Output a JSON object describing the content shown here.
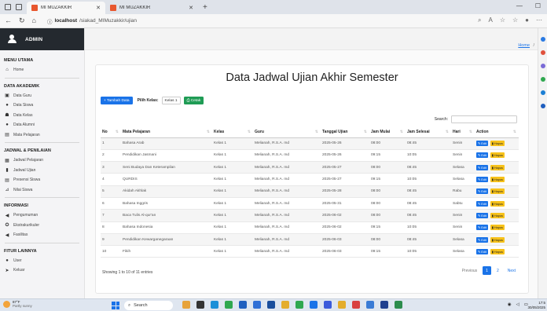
{
  "browser": {
    "tabs": [
      {
        "label": "MI MUZAKKIR",
        "active": true
      },
      {
        "label": "MI MUZAKKIR",
        "active": false
      }
    ],
    "address": {
      "host": "localhost",
      "path": "/siakad_MIMuzakkir/ujian"
    }
  },
  "sidebar": {
    "brand": "ADMIN",
    "sections": [
      {
        "title": "MENU UTAMA",
        "items": [
          {
            "label": "Home",
            "icon": "home-icon",
            "glyph": "⌂"
          }
        ]
      },
      {
        "title": "DATA AKADEMIK",
        "items": [
          {
            "label": "Data Guru",
            "icon": "teacher-icon",
            "glyph": "▣"
          },
          {
            "label": "Data Siswa",
            "icon": "student-icon",
            "glyph": "●"
          },
          {
            "label": "Data Kelas",
            "icon": "class-icon",
            "glyph": "☗"
          },
          {
            "label": "Data Alumni",
            "icon": "alumni-icon",
            "glyph": "●"
          },
          {
            "label": "Mata Pelajaran",
            "icon": "book-icon",
            "glyph": "▤"
          }
        ]
      },
      {
        "title": "JADWAL & PENILAIAN",
        "items": [
          {
            "label": "Jadwal Pelajaran",
            "icon": "calendar-icon",
            "glyph": "▦"
          },
          {
            "label": "Jadwal Ujian",
            "icon": "exam-icon",
            "glyph": "▮"
          },
          {
            "label": "Presensi Siswa",
            "icon": "attendance-icon",
            "glyph": "▤"
          },
          {
            "label": "Nilai Siswa",
            "icon": "chart-icon",
            "glyph": "⊿"
          }
        ]
      },
      {
        "title": "INFORMASI",
        "items": [
          {
            "label": "Pengumuman",
            "icon": "megaphone-icon",
            "glyph": "◀"
          },
          {
            "label": "Ekstrakurikuler",
            "icon": "activity-icon",
            "glyph": "✪"
          },
          {
            "label": "Fasilitas",
            "icon": "facility-icon",
            "glyph": "◀"
          }
        ]
      },
      {
        "title": "FITUR LAINNYA",
        "items": [
          {
            "label": "User",
            "icon": "user-icon",
            "glyph": "●"
          },
          {
            "label": "Keluar",
            "icon": "logout-icon",
            "glyph": "➤"
          }
        ]
      }
    ]
  },
  "breadcrumb": {
    "home": "Home",
    "sep": "/"
  },
  "page": {
    "title": "Data Jadwal Ujian Akhir Semester",
    "add_button": "+ Tambah Data",
    "filter_label": "Pilih Kelas:",
    "filter_value": "Kelas 1",
    "print_button": "⎙ Cetak",
    "search_label": "Search:"
  },
  "table": {
    "headers": [
      "No",
      "Mata Pelajaran",
      "Kelas",
      "Guru",
      "Tanggal Ujian",
      "Jam Mulai",
      "Jam Selesai",
      "Hari",
      "Action"
    ],
    "edit_label": "✎ Edit",
    "delete_label": "▮ Hapus",
    "rows": [
      [
        "1",
        "Bahasa Arab",
        "Kelas 1",
        "Melianah, R.S.A. md",
        "2025-05-26",
        "08:00",
        "08:45",
        "Senin"
      ],
      [
        "2",
        "Pendidikan Jasmani",
        "Kelas 1",
        "Melianah, R.S.A. md",
        "2025-05-26",
        "09:15",
        "10:05",
        "Senin"
      ],
      [
        "3",
        "Seni Budaya Dan Keterampilan",
        "Kelas 1",
        "Melianah, R.S.A. md",
        "2025-05-27",
        "08:00",
        "08:45",
        "Selasa"
      ],
      [
        "4",
        "QURDIS",
        "Kelas 1",
        "Melianah, R.S.A. md",
        "2025-05-27",
        "09:15",
        "10:05",
        "Selasa"
      ],
      [
        "5",
        "Akidah Akhlak",
        "Kelas 1",
        "Melianah, R.S.A. md",
        "2025-05-28",
        "08:00",
        "08:45",
        "Rabu"
      ],
      [
        "6",
        "Bahasa Inggris",
        "Kelas 1",
        "Melianah, R.S.A. md",
        "2025-05-31",
        "08:00",
        "08:45",
        "Sabtu"
      ],
      [
        "7",
        "Baca Tulis Al-qur'an",
        "Kelas 1",
        "Melianah, R.S.A. md",
        "2025-06-02",
        "08:00",
        "08:45",
        "Senin"
      ],
      [
        "8",
        "Bahasa Indonesia",
        "Kelas 1",
        "Melianah, R.S.A. md",
        "2025-06-02",
        "09:15",
        "10:05",
        "Senin"
      ],
      [
        "9",
        "Pendidikan Kewarganegaraan",
        "Kelas 1",
        "Melianah, R.S.A. md",
        "2025-06-03",
        "08:00",
        "08:45",
        "Selasa"
      ],
      [
        "10",
        "Fikih",
        "Kelas 1",
        "Melianah, R.S.A. md",
        "2025-06-03",
        "09:15",
        "10:05",
        "Selasa"
      ]
    ]
  },
  "footer": {
    "info": "Showing 1 to 10 of 11 entries",
    "prev": "Previous",
    "pages": [
      "1",
      "2"
    ],
    "next": "Next"
  },
  "taskbar": {
    "temp": "87°F",
    "weather": "Partly sunny",
    "search": "Search",
    "time": "17:5",
    "date": "30/05/2025"
  },
  "colors": {
    "primary": "#1a73e8",
    "success": "#1f9c55",
    "warning": "#f7c21a",
    "brand_bg": "#24292f"
  }
}
